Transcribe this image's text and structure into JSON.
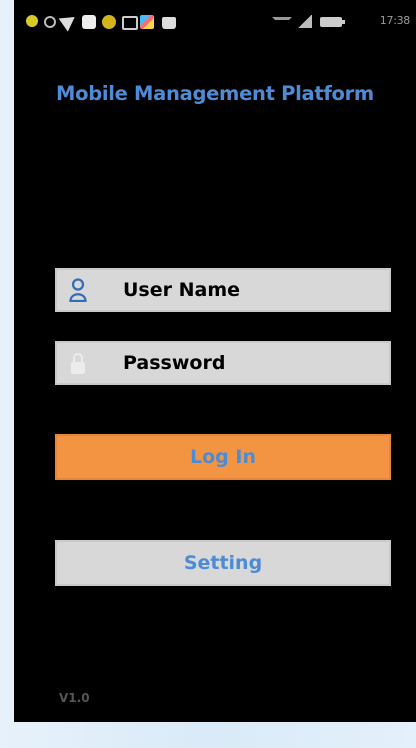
{
  "status_bar": {
    "time": "17:38",
    "icons": [
      "app-yellow-icon",
      "ring-icon",
      "send-icon",
      "square-app-icon",
      "yellow-app-icon",
      "chat-icon",
      "color-app-icon",
      "bag-icon",
      "wifi-icon",
      "signal-icon",
      "battery-icon"
    ]
  },
  "app": {
    "title": "Mobile Management Platform",
    "username": {
      "placeholder": "User Name",
      "icon": "person-icon"
    },
    "password": {
      "placeholder": "Password",
      "icon": "lock-icon"
    },
    "login_label": "Log In",
    "setting_label": "Setting",
    "version": "V1.0"
  },
  "colors": {
    "title": "#4e8bd6",
    "login_button": "#f39443",
    "field_bg": "#d8d8d8",
    "screen_bg": "#000000"
  }
}
